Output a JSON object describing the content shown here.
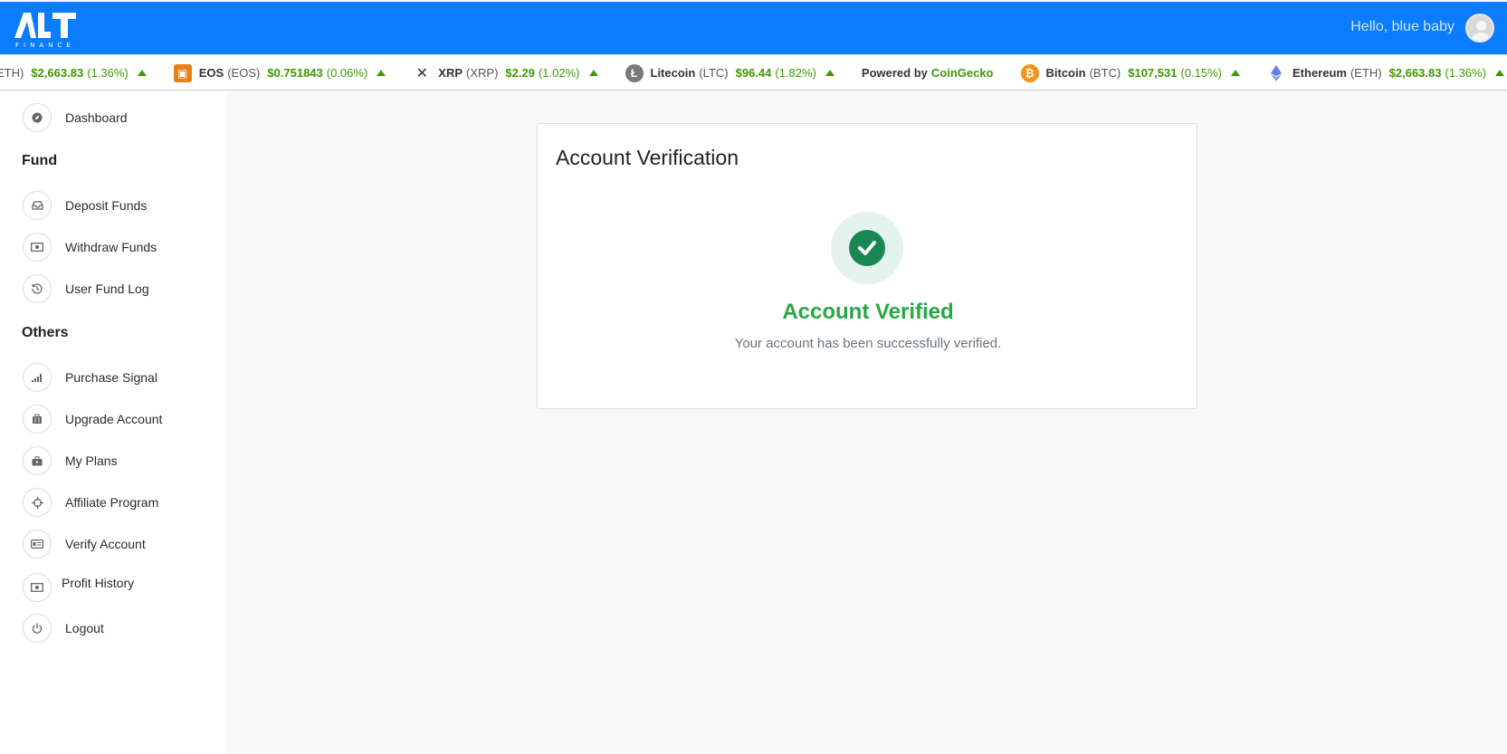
{
  "header": {
    "logo_text": "ALT FINANCE",
    "greeting": "Hello, blue baby"
  },
  "ticker": {
    "items_left": [
      {
        "name": "",
        "symbol": "ETH)",
        "price": "$2,663.83",
        "change": "(1.36%)",
        "icon": "none"
      },
      {
        "name": "EOS",
        "symbol": "(EOS)",
        "price": "$0.751843",
        "change": "(0.06%)",
        "icon": "eos-icon"
      },
      {
        "name": "XRP",
        "symbol": "(XRP)",
        "price": "$2.29",
        "change": "(1.02%)",
        "icon": "xrp-icon"
      },
      {
        "name": "Litecoin",
        "symbol": "(LTC)",
        "price": "$96.44",
        "change": "(1.82%)",
        "icon": "litecoin-icon"
      }
    ],
    "powered_by": "Powered by",
    "powered_link": "CoinGecko",
    "items_right": [
      {
        "name": "Bitcoin",
        "symbol": "(BTC)",
        "price": "$107,531",
        "change": "(0.15%)",
        "icon": "bitcoin-icon"
      },
      {
        "name": "Ethereum",
        "symbol": "(ETH)",
        "price": "$2,663.83",
        "change": "(1.36%)",
        "icon": "ethereum-icon"
      }
    ]
  },
  "sidebar": {
    "dashboard": "Dashboard",
    "fund_heading": "Fund",
    "deposit": "Deposit Funds",
    "withdraw": "Withdraw Funds",
    "fund_log": "User Fund Log",
    "others_heading": "Others",
    "purchase_signal": "Purchase Signal",
    "upgrade": "Upgrade Account",
    "my_plans": "My Plans",
    "affiliate": "Affiliate Program",
    "verify": "Verify Account",
    "profit_history": "Profit History",
    "logout": "Logout"
  },
  "card": {
    "title": "Account Verification",
    "status_title": "Account Verified",
    "status_text": "Your account has been successfully verified."
  },
  "colors": {
    "header_bg": "#0a7cff",
    "price_up": "#3d9a00",
    "success": "#28a745"
  }
}
